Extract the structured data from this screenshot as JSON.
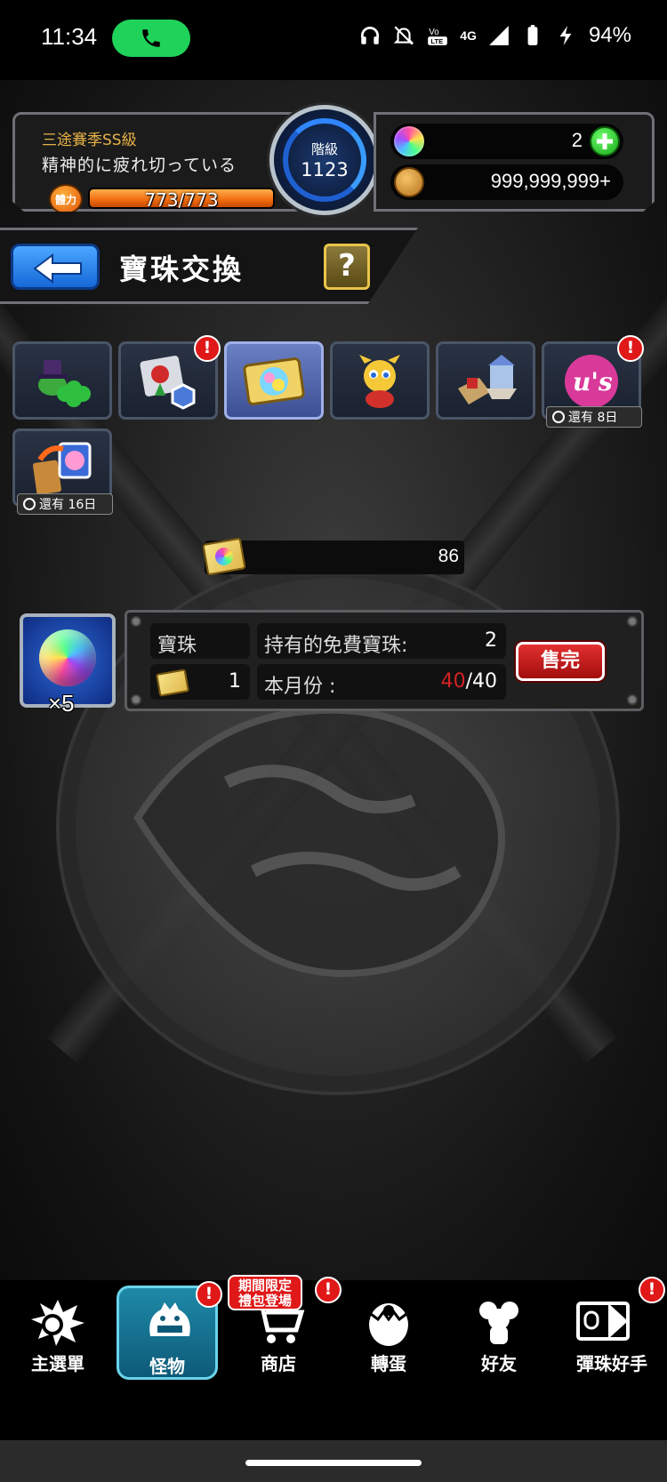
{
  "status_bar": {
    "time": "11:34",
    "network": "4G",
    "battery": "94%"
  },
  "player": {
    "rank_title": "三途賽季SS級",
    "message": "精神的に疲れ切っている",
    "stamina_label": "體力",
    "stamina": "773/773",
    "stamina_fraction": 1.0,
    "rank_label": "階級",
    "rank_value": "1123"
  },
  "resources": {
    "orbs": "2",
    "coins": "999,999,999+"
  },
  "page": {
    "title": "寶珠交換",
    "help": "?"
  },
  "tabs": [
    {
      "name": "luck-hat",
      "alert": false,
      "timer": ""
    },
    {
      "name": "gift-items",
      "alert": true,
      "timer": ""
    },
    {
      "name": "orb-ticket",
      "alert": false,
      "timer": "",
      "active": true
    },
    {
      "name": "dragon-monster",
      "alert": false,
      "timer": ""
    },
    {
      "name": "castle-map",
      "alert": false,
      "timer": ""
    },
    {
      "name": "collab-us",
      "alert": true,
      "timer": "還有 8日"
    },
    {
      "name": "trade-orb",
      "alert": false,
      "timer": "還有 16日"
    }
  ],
  "alert_mark": "!",
  "exchange": {
    "ticket_count": "86",
    "item_qty": "×5",
    "item_label": "寶珠",
    "free_orbs_label": "持有的免費寶珠:",
    "free_orbs_value": "2",
    "cost_value": "1",
    "monthly_label": "本月份 :",
    "monthly_used": "40",
    "monthly_total": "/40",
    "soldout_label": "售完"
  },
  "nav": {
    "items": [
      {
        "label": "主選單"
      },
      {
        "label": "怪物"
      },
      {
        "label": "商店"
      },
      {
        "label": "轉蛋"
      },
      {
        "label": "好友"
      },
      {
        "label": "彈珠好手"
      }
    ],
    "promo_line1": "期間限定",
    "promo_line2": "禮包登場"
  },
  "colors": {
    "accent_blue": "#1768d8",
    "alert_red": "#e01818",
    "stamina_orange": "#f06b10",
    "rank_gold": "#e7b347"
  }
}
